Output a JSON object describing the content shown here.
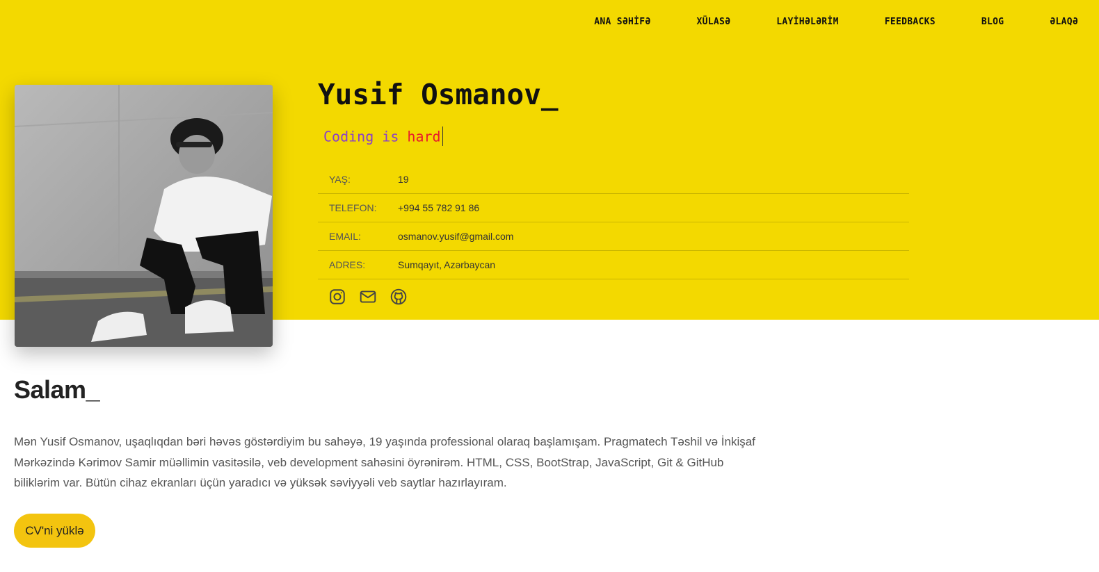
{
  "nav": {
    "items": [
      {
        "label": "ANA SƏHİFƏ"
      },
      {
        "label": "XÜLASƏ"
      },
      {
        "label": "LAYİHƏLƏRİM"
      },
      {
        "label": "FEEDBACKS"
      },
      {
        "label": "BLOG"
      },
      {
        "label": "ƏLAQƏ"
      }
    ]
  },
  "profile": {
    "name": "Yusif Osmanov_",
    "tagline_part1": "Coding is ",
    "tagline_part2": "hard",
    "info": [
      {
        "key": "YAŞ:",
        "value": "19"
      },
      {
        "key": "TELEFON:",
        "value": "+994 55 782 91 86"
      },
      {
        "key": "EMAIL:",
        "value": "osmanov.yusif@gmail.com"
      },
      {
        "key": "ADRES:",
        "value": "Sumqayıt, Azərbaycan"
      }
    ],
    "socials": [
      "instagram-icon",
      "mail-icon",
      "github-icon"
    ]
  },
  "about": {
    "title": "Salam_",
    "text": "Mən Yusif Osmanov, uşaqlıqdan bəri həvəs göstərdiyim bu sahəyə, 19 yaşında professional olaraq başlamışam. Pragmatech Təshil və İnkişaf Mərkəzində Kərimov Samir müəllimin vasitəsilə, veb development sahəsini öyrənirəm. HTML, CSS, BootStrap, JavaScript, Git & GitHub biliklərim var. Bütün cihaz ekranları üçün yaradıcı və yüksək səviyyəli veb saytlar hazırlayıram.",
    "cv_label": "CV'ni yüklə"
  },
  "colors": {
    "hero_bg": "#f3d900",
    "tagline": "#8a3fc9",
    "tagline_highlight": "#e8192c",
    "button": "#f3c40f"
  }
}
